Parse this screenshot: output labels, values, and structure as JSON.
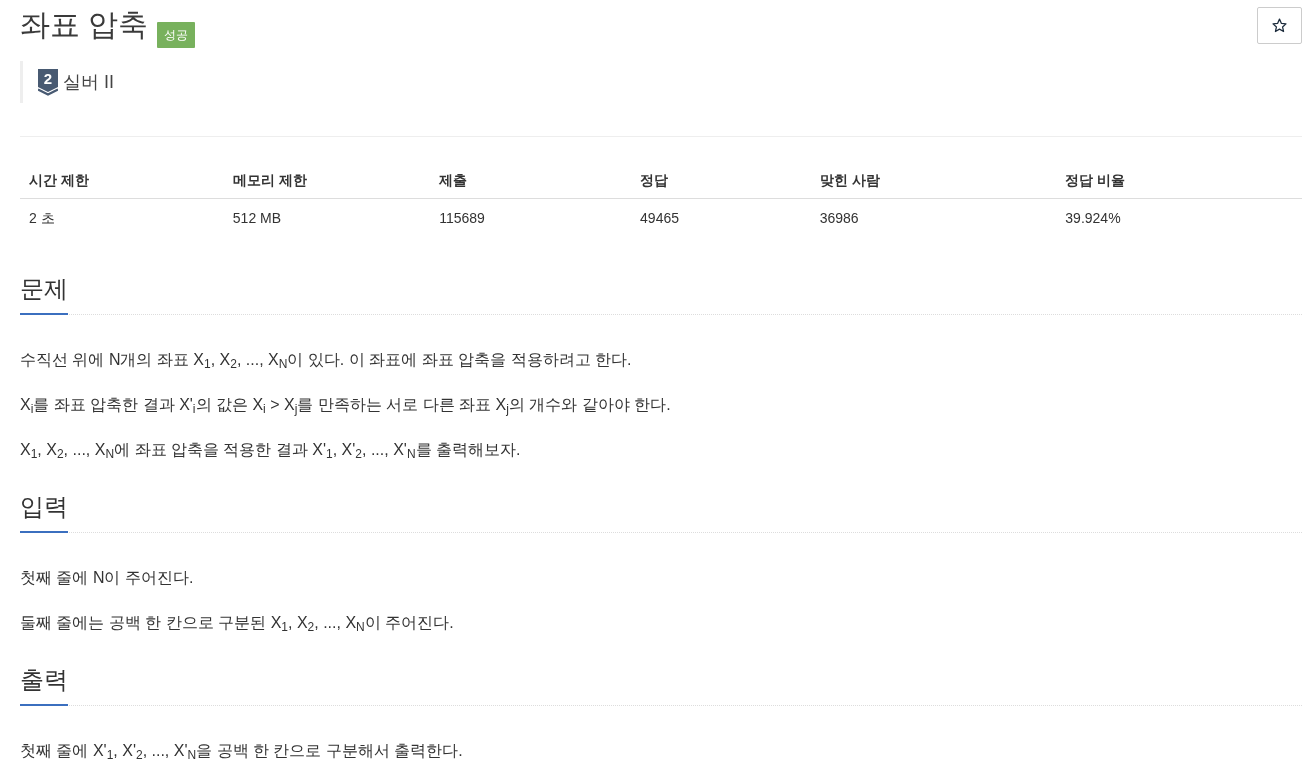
{
  "title": "좌표 압축",
  "result": {
    "label": "성공",
    "kind": "success"
  },
  "favorite": {
    "on": false
  },
  "tier": {
    "digit": "2",
    "name": "실버 II"
  },
  "info_table": {
    "columns": [
      "시간 제한",
      "메모리 제한",
      "제출",
      "정답",
      "맞힌 사람",
      "정답 비율"
    ],
    "rows": [
      [
        "2 초",
        "512 MB",
        "115689",
        "49465",
        "36986",
        "39.924%"
      ]
    ]
  },
  "sections": [
    {
      "heading": "문제",
      "paragraphs": [
        "수직선 위에 N개의 좌표 X$_{1}$, X$_{2}$, ..., X$_{N}$이 있다. 이 좌표에 좌표 압축을 적용하려고 한다.",
        "X$_{i}$를 좌표 압축한 결과 X'$_{i}$의 값은 X$_{i}$ > X$_{j}$를 만족하는 서로 다른 좌표 X$_{j}$의 개수와 같아야 한다.",
        "X$_{1}$, X$_{2}$, ..., X$_{N}$에 좌표 압축을 적용한 결과 X'$_{1}$, X'$_{2}$, ..., X'$_{N}$를 출력해보자."
      ]
    },
    {
      "heading": "입력",
      "paragraphs": [
        "첫째 줄에 N이 주어진다.",
        "둘째 줄에는 공백 한 칸으로 구분된 X$_{1}$, X$_{2}$, ..., X$_{N}$이 주어진다."
      ]
    },
    {
      "heading": "출력",
      "paragraphs": [
        "첫째 줄에 X'$_{1}$, X'$_{2}$, ..., X'$_{N}$을 공백 한 칸으로 구분해서 출력한다."
      ]
    }
  ]
}
